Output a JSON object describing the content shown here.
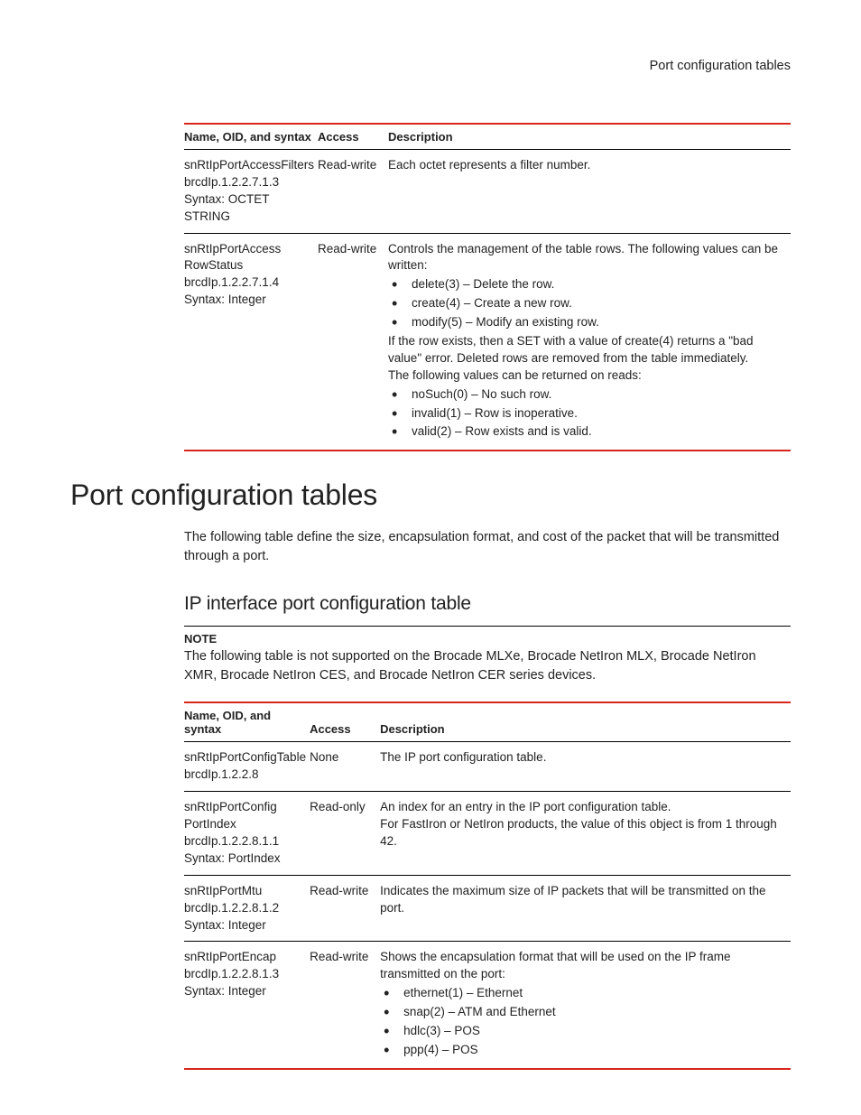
{
  "header": {
    "title": "Port configuration tables"
  },
  "table1": {
    "headers": {
      "name": "Name, OID, and syntax",
      "access": "Access",
      "desc": "Description"
    },
    "rows": [
      {
        "name1": "snRtIpPortAccessFilters",
        "name2": "brcdIp.1.2.2.7.1.3",
        "name3": "Syntax: OCTET STRING",
        "access": "Read-write",
        "desc_p1": "Each octet represents a filter number."
      },
      {
        "name1": "snRtIpPortAccessRowStatus",
        "name2": "brcdIp.1.2.2.7.1.4",
        "name3": "Syntax: Integer",
        "access": "Read-write",
        "desc_p1": "Controls the management of the table rows. The following values can be written:",
        "b1": "delete(3) – Delete the row.",
        "b2": "create(4) – Create a new row.",
        "b3": "modify(5) – Modify an existing row.",
        "desc_p2": "If the row exists, then a SET with a value of create(4) returns a \"bad value\" error. Deleted rows are removed from the table immediately.",
        "desc_p3": "The following values can be returned on reads:",
        "b4": "noSuch(0) – No such row.",
        "b5": "invalid(1) – Row is inoperative.",
        "b6": "valid(2) – Row exists and is valid."
      }
    ]
  },
  "main": {
    "heading": "Port configuration tables",
    "intro": "The following table define the size, encapsulation format, and cost of the packet that will be transmitted through a port.",
    "subheading": "IP interface port configuration table",
    "note_label": "NOTE",
    "note_text": "The following table is not supported on the Brocade MLXe, Brocade NetIron MLX, Brocade NetIron XMR, Brocade NetIron CES, and Brocade NetIron CER series devices."
  },
  "table2": {
    "headers": {
      "name": "Name, OID, and syntax",
      "access": "Access",
      "desc": "Description"
    },
    "rows": [
      {
        "name1": "snRtIpPortConfigTable",
        "name2": "brcdIp.1.2.2.8",
        "access": "None",
        "desc_p1": "The IP port configuration table."
      },
      {
        "name1": "snRtIpPortConfigPortIndex",
        "name2": "brcdIp.1.2.2.8.1.1",
        "name3": "Syntax: PortIndex",
        "access": "Read-only",
        "desc_p1": "An index for an entry in the IP port configuration table.",
        "desc_p2": "For FastIron or NetIron products, the value of this object is from 1 through 42."
      },
      {
        "name1": "snRtIpPortMtu",
        "name2": "brcdIp.1.2.2.8.1.2",
        "name3": "Syntax: Integer",
        "access": "Read-write",
        "desc_p1": "Indicates the maximum size of IP packets that will be transmitted on the port."
      },
      {
        "name1": "snRtIpPortEncap",
        "name2": "brcdIp.1.2.2.8.1.3",
        "name3": "Syntax: Integer",
        "access": "Read-write",
        "desc_p1": "Shows the encapsulation format that will be used on the IP frame transmitted on the port:",
        "b1": "ethernet(1) – Ethernet",
        "b2": "snap(2) – ATM and Ethernet",
        "b3": "hdlc(3) – POS",
        "b4": "ppp(4) – POS"
      }
    ]
  }
}
